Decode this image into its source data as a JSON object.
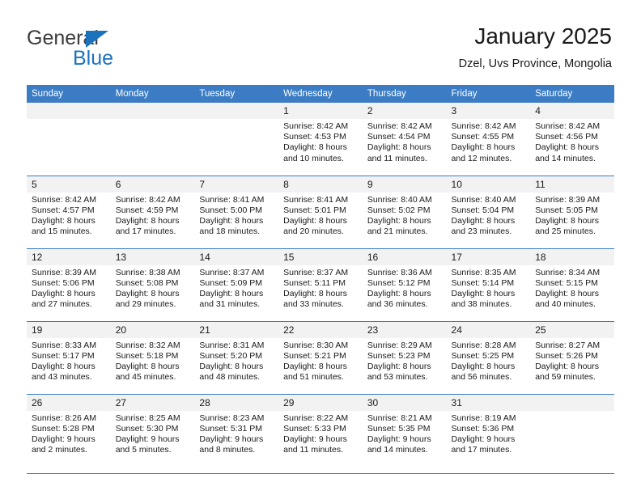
{
  "brand": {
    "name_part1": "General",
    "name_part2": "Blue",
    "logo_icon": "blue-triangle-icon",
    "accent_color": "#1b72bd"
  },
  "header": {
    "title": "January 2025",
    "subtitle": "Dzel, Uvs Province, Mongolia"
  },
  "theme": {
    "header_background": "#3b7cc4",
    "header_text": "#ffffff",
    "daynum_background": "#f2f2f2",
    "rule_color": "#3b7cc4"
  },
  "weekday_headers": [
    "Sunday",
    "Monday",
    "Tuesday",
    "Wednesday",
    "Thursday",
    "Friday",
    "Saturday"
  ],
  "weeks": [
    [
      {
        "day": "",
        "sunrise": "",
        "sunset": "",
        "daylight_line1": "",
        "daylight_line2": ""
      },
      {
        "day": "",
        "sunrise": "",
        "sunset": "",
        "daylight_line1": "",
        "daylight_line2": ""
      },
      {
        "day": "",
        "sunrise": "",
        "sunset": "",
        "daylight_line1": "",
        "daylight_line2": ""
      },
      {
        "day": "1",
        "sunrise": "Sunrise: 8:42 AM",
        "sunset": "Sunset: 4:53 PM",
        "daylight_line1": "Daylight: 8 hours",
        "daylight_line2": "and 10 minutes."
      },
      {
        "day": "2",
        "sunrise": "Sunrise: 8:42 AM",
        "sunset": "Sunset: 4:54 PM",
        "daylight_line1": "Daylight: 8 hours",
        "daylight_line2": "and 11 minutes."
      },
      {
        "day": "3",
        "sunrise": "Sunrise: 8:42 AM",
        "sunset": "Sunset: 4:55 PM",
        "daylight_line1": "Daylight: 8 hours",
        "daylight_line2": "and 12 minutes."
      },
      {
        "day": "4",
        "sunrise": "Sunrise: 8:42 AM",
        "sunset": "Sunset: 4:56 PM",
        "daylight_line1": "Daylight: 8 hours",
        "daylight_line2": "and 14 minutes."
      }
    ],
    [
      {
        "day": "5",
        "sunrise": "Sunrise: 8:42 AM",
        "sunset": "Sunset: 4:57 PM",
        "daylight_line1": "Daylight: 8 hours",
        "daylight_line2": "and 15 minutes."
      },
      {
        "day": "6",
        "sunrise": "Sunrise: 8:42 AM",
        "sunset": "Sunset: 4:59 PM",
        "daylight_line1": "Daylight: 8 hours",
        "daylight_line2": "and 17 minutes."
      },
      {
        "day": "7",
        "sunrise": "Sunrise: 8:41 AM",
        "sunset": "Sunset: 5:00 PM",
        "daylight_line1": "Daylight: 8 hours",
        "daylight_line2": "and 18 minutes."
      },
      {
        "day": "8",
        "sunrise": "Sunrise: 8:41 AM",
        "sunset": "Sunset: 5:01 PM",
        "daylight_line1": "Daylight: 8 hours",
        "daylight_line2": "and 20 minutes."
      },
      {
        "day": "9",
        "sunrise": "Sunrise: 8:40 AM",
        "sunset": "Sunset: 5:02 PM",
        "daylight_line1": "Daylight: 8 hours",
        "daylight_line2": "and 21 minutes."
      },
      {
        "day": "10",
        "sunrise": "Sunrise: 8:40 AM",
        "sunset": "Sunset: 5:04 PM",
        "daylight_line1": "Daylight: 8 hours",
        "daylight_line2": "and 23 minutes."
      },
      {
        "day": "11",
        "sunrise": "Sunrise: 8:39 AM",
        "sunset": "Sunset: 5:05 PM",
        "daylight_line1": "Daylight: 8 hours",
        "daylight_line2": "and 25 minutes."
      }
    ],
    [
      {
        "day": "12",
        "sunrise": "Sunrise: 8:39 AM",
        "sunset": "Sunset: 5:06 PM",
        "daylight_line1": "Daylight: 8 hours",
        "daylight_line2": "and 27 minutes."
      },
      {
        "day": "13",
        "sunrise": "Sunrise: 8:38 AM",
        "sunset": "Sunset: 5:08 PM",
        "daylight_line1": "Daylight: 8 hours",
        "daylight_line2": "and 29 minutes."
      },
      {
        "day": "14",
        "sunrise": "Sunrise: 8:37 AM",
        "sunset": "Sunset: 5:09 PM",
        "daylight_line1": "Daylight: 8 hours",
        "daylight_line2": "and 31 minutes."
      },
      {
        "day": "15",
        "sunrise": "Sunrise: 8:37 AM",
        "sunset": "Sunset: 5:11 PM",
        "daylight_line1": "Daylight: 8 hours",
        "daylight_line2": "and 33 minutes."
      },
      {
        "day": "16",
        "sunrise": "Sunrise: 8:36 AM",
        "sunset": "Sunset: 5:12 PM",
        "daylight_line1": "Daylight: 8 hours",
        "daylight_line2": "and 36 minutes."
      },
      {
        "day": "17",
        "sunrise": "Sunrise: 8:35 AM",
        "sunset": "Sunset: 5:14 PM",
        "daylight_line1": "Daylight: 8 hours",
        "daylight_line2": "and 38 minutes."
      },
      {
        "day": "18",
        "sunrise": "Sunrise: 8:34 AM",
        "sunset": "Sunset: 5:15 PM",
        "daylight_line1": "Daylight: 8 hours",
        "daylight_line2": "and 40 minutes."
      }
    ],
    [
      {
        "day": "19",
        "sunrise": "Sunrise: 8:33 AM",
        "sunset": "Sunset: 5:17 PM",
        "daylight_line1": "Daylight: 8 hours",
        "daylight_line2": "and 43 minutes."
      },
      {
        "day": "20",
        "sunrise": "Sunrise: 8:32 AM",
        "sunset": "Sunset: 5:18 PM",
        "daylight_line1": "Daylight: 8 hours",
        "daylight_line2": "and 45 minutes."
      },
      {
        "day": "21",
        "sunrise": "Sunrise: 8:31 AM",
        "sunset": "Sunset: 5:20 PM",
        "daylight_line1": "Daylight: 8 hours",
        "daylight_line2": "and 48 minutes."
      },
      {
        "day": "22",
        "sunrise": "Sunrise: 8:30 AM",
        "sunset": "Sunset: 5:21 PM",
        "daylight_line1": "Daylight: 8 hours",
        "daylight_line2": "and 51 minutes."
      },
      {
        "day": "23",
        "sunrise": "Sunrise: 8:29 AM",
        "sunset": "Sunset: 5:23 PM",
        "daylight_line1": "Daylight: 8 hours",
        "daylight_line2": "and 53 minutes."
      },
      {
        "day": "24",
        "sunrise": "Sunrise: 8:28 AM",
        "sunset": "Sunset: 5:25 PM",
        "daylight_line1": "Daylight: 8 hours",
        "daylight_line2": "and 56 minutes."
      },
      {
        "day": "25",
        "sunrise": "Sunrise: 8:27 AM",
        "sunset": "Sunset: 5:26 PM",
        "daylight_line1": "Daylight: 8 hours",
        "daylight_line2": "and 59 minutes."
      }
    ],
    [
      {
        "day": "26",
        "sunrise": "Sunrise: 8:26 AM",
        "sunset": "Sunset: 5:28 PM",
        "daylight_line1": "Daylight: 9 hours",
        "daylight_line2": "and 2 minutes."
      },
      {
        "day": "27",
        "sunrise": "Sunrise: 8:25 AM",
        "sunset": "Sunset: 5:30 PM",
        "daylight_line1": "Daylight: 9 hours",
        "daylight_line2": "and 5 minutes."
      },
      {
        "day": "28",
        "sunrise": "Sunrise: 8:23 AM",
        "sunset": "Sunset: 5:31 PM",
        "daylight_line1": "Daylight: 9 hours",
        "daylight_line2": "and 8 minutes."
      },
      {
        "day": "29",
        "sunrise": "Sunrise: 8:22 AM",
        "sunset": "Sunset: 5:33 PM",
        "daylight_line1": "Daylight: 9 hours",
        "daylight_line2": "and 11 minutes."
      },
      {
        "day": "30",
        "sunrise": "Sunrise: 8:21 AM",
        "sunset": "Sunset: 5:35 PM",
        "daylight_line1": "Daylight: 9 hours",
        "daylight_line2": "and 14 minutes."
      },
      {
        "day": "31",
        "sunrise": "Sunrise: 8:19 AM",
        "sunset": "Sunset: 5:36 PM",
        "daylight_line1": "Daylight: 9 hours",
        "daylight_line2": "and 17 minutes."
      },
      {
        "day": "",
        "sunrise": "",
        "sunset": "",
        "daylight_line1": "",
        "daylight_line2": ""
      }
    ]
  ]
}
